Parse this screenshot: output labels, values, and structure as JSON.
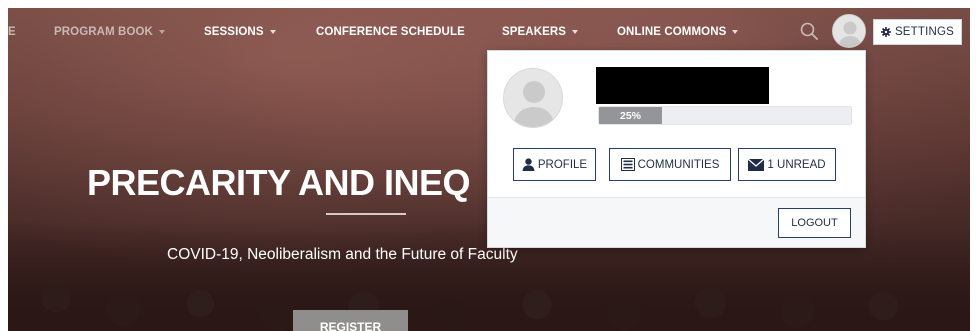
{
  "nav": {
    "items": [
      {
        "label": "E",
        "has_caret": false
      },
      {
        "label": "PROGRAM BOOK",
        "has_caret": true
      },
      {
        "label": "SESSIONS",
        "has_caret": true
      },
      {
        "label": "CONFERENCE SCHEDULE",
        "has_caret": false
      },
      {
        "label": "SPEAKERS",
        "has_caret": true
      },
      {
        "label": "ONLINE COMMONS",
        "has_caret": true
      }
    ],
    "search_icon": "search-icon",
    "settings_label": "SETTINGS",
    "settings_icon": "gear-icon"
  },
  "hero": {
    "title": "PRECARITY AND INEQ",
    "subtitle": "COVID-19, Neoliberalism and the Future of Faculty",
    "register_label": "REGISTER"
  },
  "user_panel": {
    "progress_value": 0.25,
    "progress_label": "25%",
    "buttons": [
      {
        "label": "PROFILE",
        "icon": "user-icon"
      },
      {
        "label": "COMMUNITIES",
        "icon": "list-icon"
      },
      {
        "label": "1 UNREAD",
        "icon": "envelope-icon"
      }
    ],
    "logout_label": "LOGOUT"
  },
  "colors": {
    "navy": "#1f2e48",
    "progress_fill": "#939598",
    "register_bg": "#8f8e8d"
  }
}
